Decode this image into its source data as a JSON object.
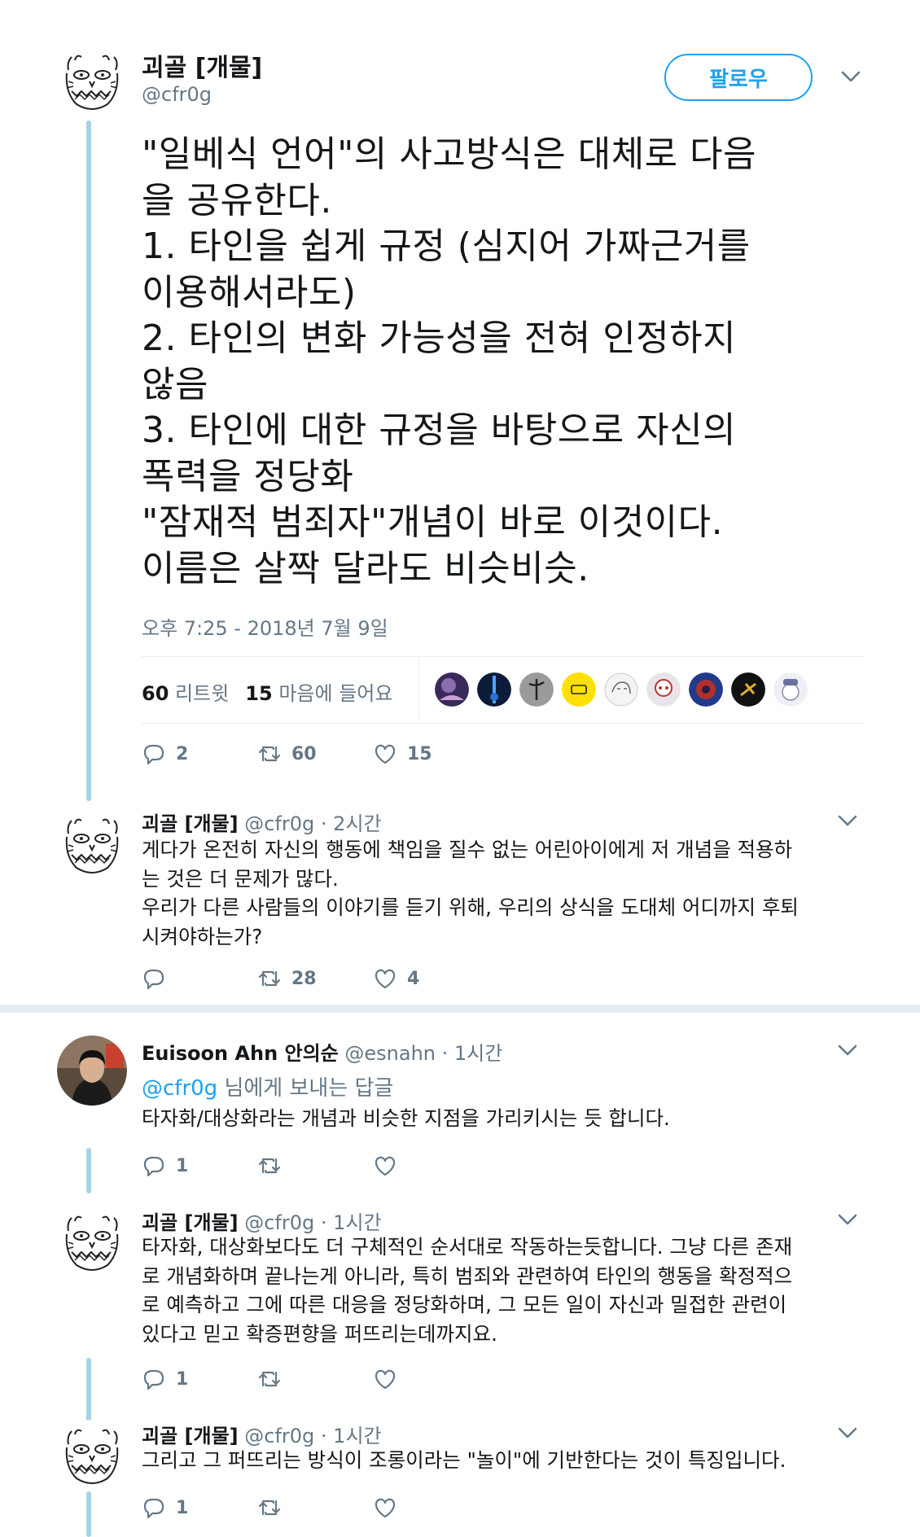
{
  "main": {
    "name": "괴골 [개물]",
    "handle": "@cfr0g",
    "follow_label": "팔로우",
    "text": "\"일베식 언어\"의 사고방식은 대체로 다음\n을 공유한다.\n1. 타인을 쉽게 규정 (심지어 가짜근거를\n이용해서라도)\n2. 타인의 변화 가능성을 전혀 인정하지\n않음\n3. 타인에 대한 규정을 바탕으로 자신의\n폭력을 정당화\n\"잠재적 범죄자\"개념이 바로 이것이다.\n이름은 살짝 달라도 비슷비슷.",
    "timestamp": "오후 7:25 - 2018년 7월 9일",
    "retweet_count": "60",
    "retweet_label": "리트윗",
    "like_count": "15",
    "like_label": "마음에 들어요",
    "actions": {
      "reply": "2",
      "retweet": "60",
      "like": "15"
    }
  },
  "replies": [
    {
      "name": "괴골 [개물]",
      "handle": "@cfr0g",
      "time": "· 2시간",
      "text": "게다가 온전히 자신의 행동에 책임을 질수 없는 어린아이에게 저 개념을 적용하\n는 것은 더 문제가 많다.\n우리가 다른 사람들의 이야기를 듣기 위해, 우리의 상식을 도대체 어디까지 후퇴\n시켜야하는가?",
      "reply": "",
      "retweet": "28",
      "like": "4"
    },
    {
      "name": "Euisoon Ahn 안의순",
      "handle": "@esnahn",
      "time": "· 1시간",
      "replying_to": "@cfr0g",
      "replying_suffix": " 님에게 보내는 답글",
      "text": "타자화/대상화라는 개념과 비슷한 지점을 가리키시는 듯 합니다.",
      "reply": "1",
      "retweet": "",
      "like": ""
    },
    {
      "name": "괴골 [개물]",
      "handle": "@cfr0g",
      "time": "· 1시간",
      "text": "타자화, 대상화보다도 더 구체적인 순서대로 작동하는듯합니다. 그냥 다른 존재\n로 개념화하며 끝나는게 아니라, 특히 범죄와 관련하여 타인의 행동을 확정적으\n로 예측하고 그에 따른 대응을 정당화하며, 그 모든 일이 자신과 밀접한 관련이\n있다고 믿고 확증편향을 퍼뜨리는데까지요.",
      "reply": "1",
      "retweet": "",
      "like": ""
    },
    {
      "name": "괴골 [개물]",
      "handle": "@cfr0g",
      "time": "· 1시간",
      "text": "그리고 그 퍼뜨리는 방식이 조롱이라는 \"놀이\"에 기반한다는 것이 특징입니다.",
      "reply": "1",
      "retweet": "",
      "like": ""
    }
  ],
  "icons": [
    "doodle-avatar-icon",
    "photo-avatar-icon",
    "chevron-down-icon",
    "reply-icon",
    "retweet-icon",
    "heart-icon"
  ],
  "colors": {
    "accent": "#1da1f2",
    "muted": "#657786",
    "thread": "#a7d3e6",
    "divider": "#e6ecf0"
  }
}
